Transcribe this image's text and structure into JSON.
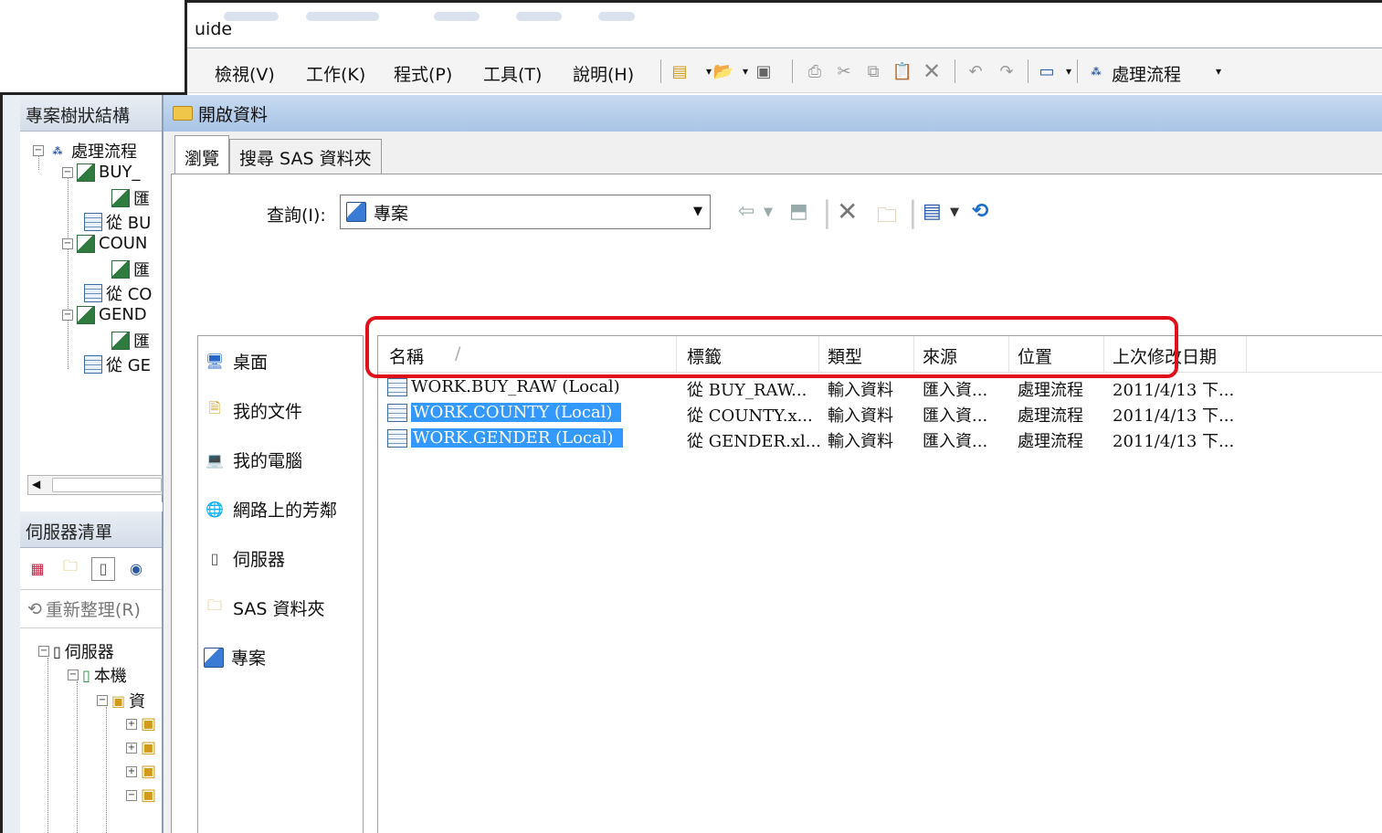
{
  "app": {
    "title_partial": "uide",
    "menus": [
      "檢視(V)",
      "工作(K)",
      "程式(P)",
      "工具(T)",
      "說明(H)"
    ],
    "toolbar_process_flow_label": "處理流程"
  },
  "project_pane": {
    "header": "專案樹狀結構",
    "items": [
      {
        "label": "處理流程"
      },
      {
        "label": "BUY_"
      },
      {
        "label": "匯"
      },
      {
        "label": "從 BU"
      },
      {
        "label": "COUN"
      },
      {
        "label": "匯"
      },
      {
        "label": "從 CO"
      },
      {
        "label": "GEND"
      },
      {
        "label": "匯"
      },
      {
        "label": "從 GE"
      }
    ]
  },
  "server_pane": {
    "header": "伺服器清單",
    "refresh_label": "重新整理(R)",
    "tree": [
      {
        "label": "伺服器"
      },
      {
        "label": "本機"
      },
      {
        "label": "資"
      }
    ]
  },
  "dialog": {
    "title": "開啟資料",
    "tabs": [
      {
        "label": "瀏覽",
        "active": true
      },
      {
        "label": "搜尋 SAS 資料夾",
        "active": false
      }
    ],
    "look_in_label": "查詢(I):",
    "look_in_value": "專案",
    "places": [
      {
        "label": "桌面",
        "icon": "desktop-icon"
      },
      {
        "label": "我的文件",
        "icon": "documents-icon"
      },
      {
        "label": "我的電腦",
        "icon": "computer-icon"
      },
      {
        "label": "網路上的芳鄰",
        "icon": "network-icon"
      },
      {
        "label": "伺服器",
        "icon": "server-icon"
      },
      {
        "label": "SAS 資料夾",
        "icon": "sas-folder-icon"
      },
      {
        "label": "專案",
        "icon": "project-icon"
      }
    ],
    "columns": [
      "名稱",
      "標籤",
      "類型",
      "來源",
      "位置",
      "上次修改日期"
    ],
    "sort_indicator": "/",
    "files": [
      {
        "name": "WORK.BUY_RAW (Local)",
        "label": "從 BUY_RAW...",
        "type": "輸入資料",
        "source": "匯入資...",
        "location": "處理流程",
        "modified": "2011/4/13 下...",
        "selected": false
      },
      {
        "name": "WORK.COUNTY (Local)",
        "label": "從 COUNTY.x...",
        "type": "輸入資料",
        "source": "匯入資...",
        "location": "處理流程",
        "modified": "2011/4/13 下...",
        "selected": true
      },
      {
        "name": "WORK.GENDER (Local)",
        "label": "從 GENDER.xl...",
        "type": "輸入資料",
        "source": "匯入資...",
        "location": "處理流程",
        "modified": "2011/4/13 下...",
        "selected": true
      }
    ]
  },
  "colors": {
    "selection": "#3399ff",
    "highlight_box": "#e0101a"
  }
}
